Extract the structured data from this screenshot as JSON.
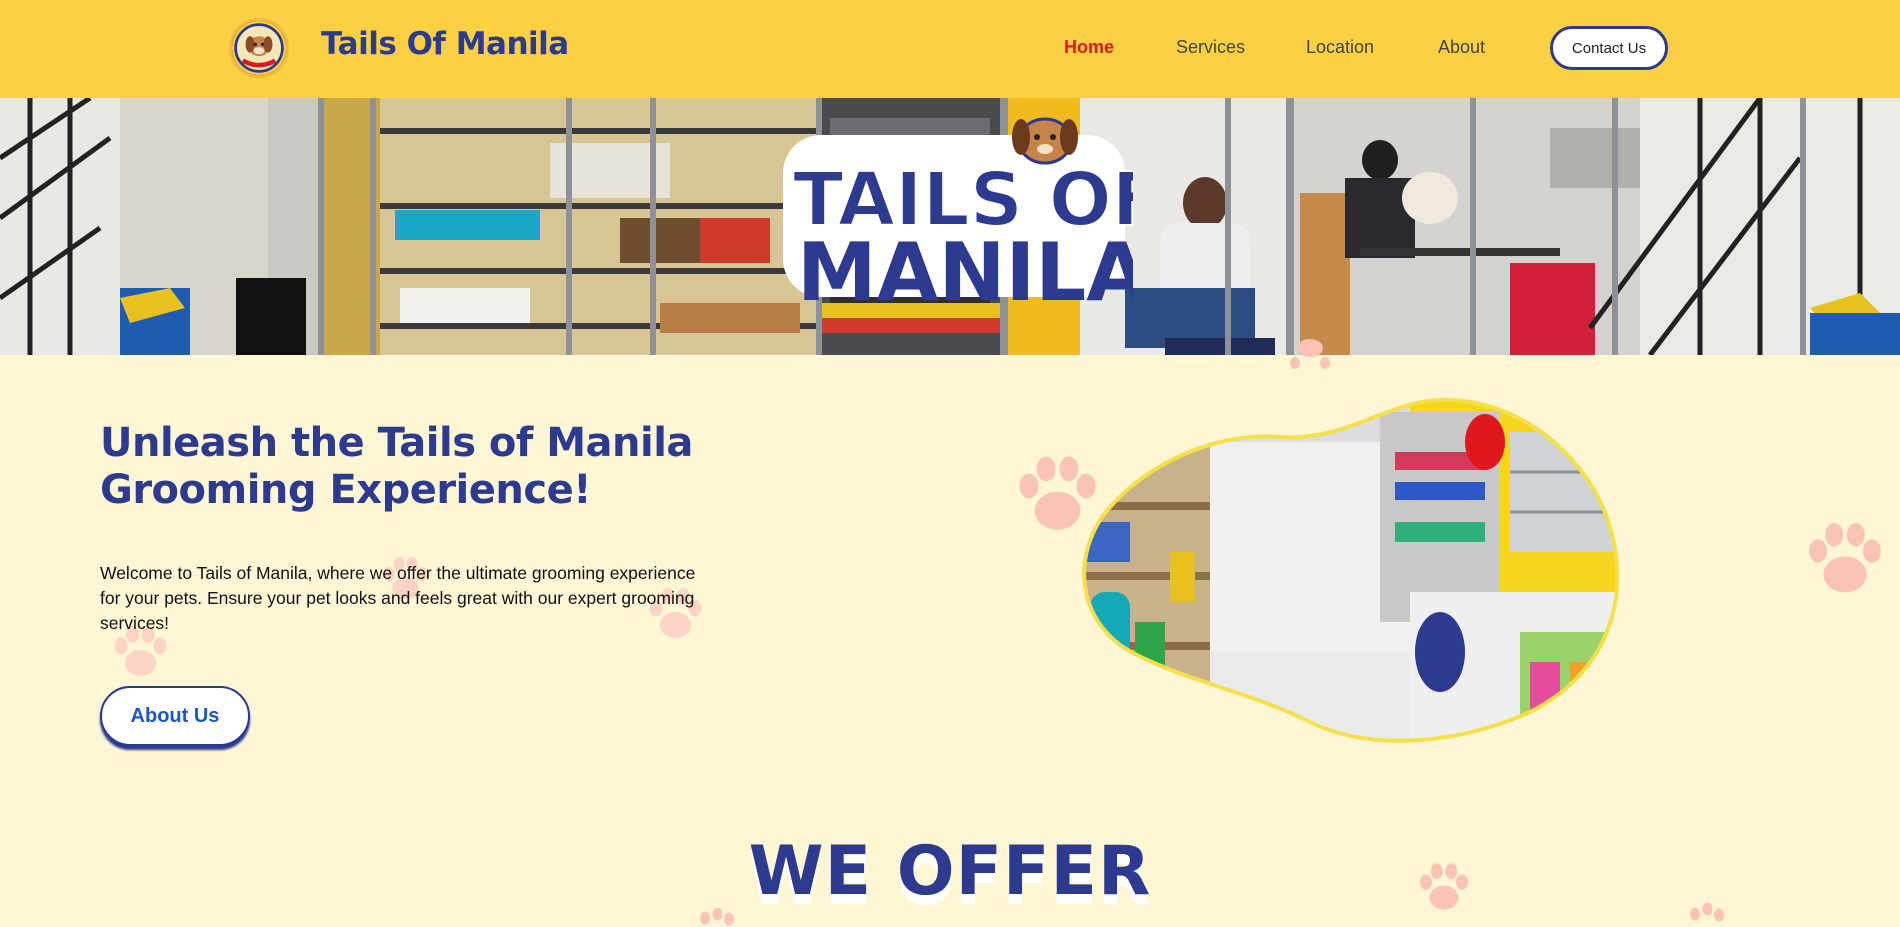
{
  "nav": {
    "brand": "Tails Of Manila",
    "links": [
      {
        "label": "Home",
        "active": true
      },
      {
        "label": "Services",
        "active": false
      },
      {
        "label": "Location",
        "active": false
      },
      {
        "label": "About",
        "active": false
      }
    ],
    "contact_label": "Contact Us"
  },
  "hero": {
    "logo_line1": "TAILS OF",
    "logo_line2": "MANILA"
  },
  "intro": {
    "headline": "Unleash the Tails of Manila Grooming Experience!",
    "body": "Welcome to Tails of Manila, where we offer the ultimate grooming experience for your pets. Ensure your pet looks and feels great with our expert grooming services!",
    "about_button": "About Us"
  },
  "section": {
    "title": "WE OFFER"
  },
  "colors": {
    "brand_navy": "#2c3a8f",
    "nav_yellow": "#fcd043",
    "page_cream": "#fff6d6",
    "active_red": "#e0181e",
    "paw_pink": "#f9c4b4"
  },
  "icons": [
    "paw-icon",
    "dog-logo-icon"
  ]
}
